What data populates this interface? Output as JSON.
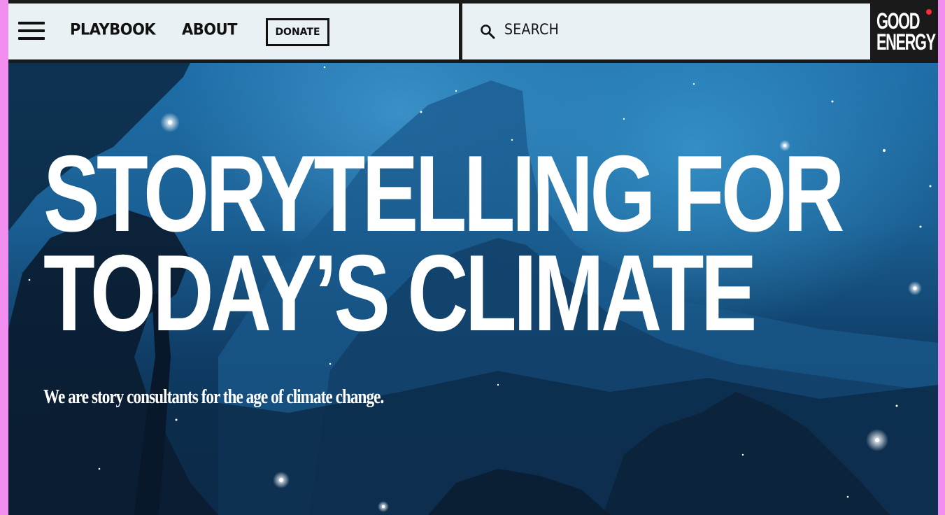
{
  "nav": {
    "menu_icon": "hamburger-menu-icon",
    "links": [
      {
        "label": "PLAYBOOK"
      },
      {
        "label": "ABOUT"
      }
    ],
    "donate_label": "DONATE"
  },
  "search": {
    "icon": "search-icon",
    "label": "SEARCH"
  },
  "logo": {
    "line1": "GOOD",
    "line2": "ENERGY",
    "dot_color": "#ff2a3d"
  },
  "hero": {
    "headline_line1": "STORYTELLING FOR",
    "headline_line2": "TODAY’S CLIMATE",
    "subhead": "We are story consultants for the age of climate change."
  },
  "colors": {
    "page_border": "#f28ef0",
    "nav_bg": "#e9f1f5",
    "nav_dark": "#1a1a1a",
    "hero_blue": "#1f6ea8"
  }
}
